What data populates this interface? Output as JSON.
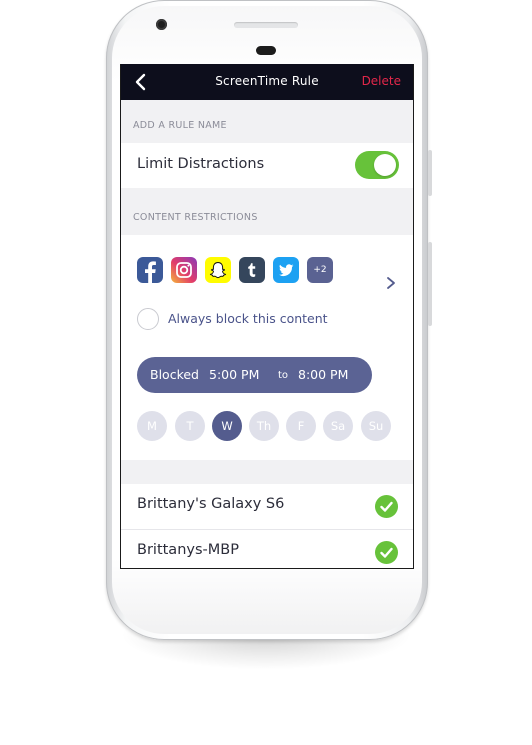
{
  "header": {
    "back_icon": "chevron-left-icon",
    "title": "ScreenTime Rule",
    "delete_label": "Delete",
    "delete_color": "#e2274a"
  },
  "rule_section": {
    "label": "ADD A RULE NAME",
    "name": "Limit Distractions",
    "enabled": true,
    "toggle_color": "#67c23a"
  },
  "content_section": {
    "label": "CONTENT RESTRICTIONS",
    "apps": [
      {
        "name": "facebook",
        "icon": "facebook-icon",
        "color": "#3b5998"
      },
      {
        "name": "instagram",
        "icon": "instagram-icon",
        "color": "#c13584"
      },
      {
        "name": "snapchat",
        "icon": "snapchat-icon",
        "color": "#fffc00"
      },
      {
        "name": "tumblr",
        "icon": "tumblr-icon",
        "color": "#35465c"
      },
      {
        "name": "twitter",
        "icon": "twitter-icon",
        "color": "#1da1f2"
      }
    ],
    "more_count": "+2",
    "always_block_label": "Always block this content",
    "always_block_checked": false,
    "schedule": {
      "status": "Blocked",
      "from": "5:00 PM",
      "separator": "to",
      "until": "8:00 PM"
    },
    "days": [
      {
        "label": "M",
        "active": false
      },
      {
        "label": "T",
        "active": false
      },
      {
        "label": "W",
        "active": true
      },
      {
        "label": "Th",
        "active": false
      },
      {
        "label": "F",
        "active": false
      },
      {
        "label": "Sa",
        "active": false
      },
      {
        "label": "Su",
        "active": false
      }
    ]
  },
  "devices": [
    {
      "name": "Brittany's Galaxy S6",
      "selected": true
    },
    {
      "name": "Brittanys-MBP",
      "selected": true
    }
  ]
}
